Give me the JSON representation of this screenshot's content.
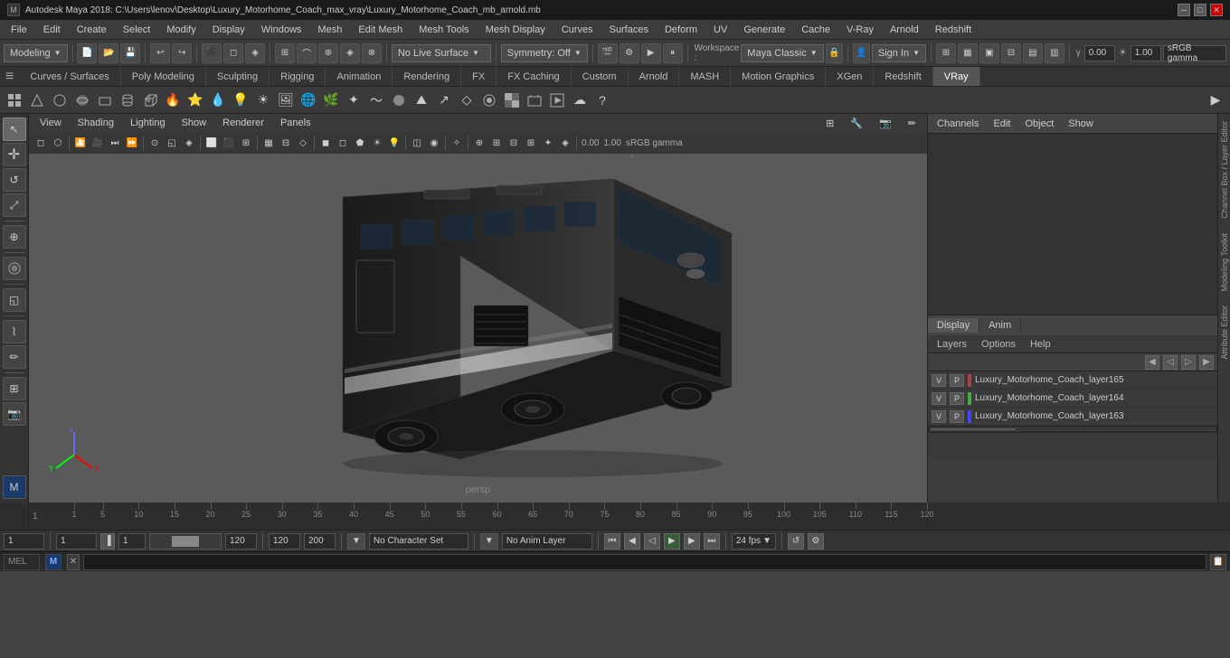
{
  "titlebar": {
    "title": "Autodesk Maya 2018: C:\\Users\\lenov\\Desktop\\Luxury_Motorhome_Coach_max_vray\\Luxury_Motorhome_Coach_mb_arnold.mb",
    "icon": "M"
  },
  "menubar": {
    "items": [
      "File",
      "Edit",
      "Create",
      "Select",
      "Modify",
      "Display",
      "Windows",
      "Mesh",
      "Edit Mesh",
      "Mesh Tools",
      "Mesh Display",
      "Curves",
      "Surfaces",
      "Deform",
      "UV",
      "Generate",
      "Cache",
      "V-Ray",
      "Arnold",
      "Redshift"
    ]
  },
  "toolbar1": {
    "mode_dropdown": "Modeling",
    "live_surface": "No Live Surface",
    "symmetry": "Symmetry: Off",
    "workspace_label": "Workspace :",
    "workspace_value": "Maya Classic",
    "sign_in": "Sign In",
    "gamma_value": "0.00",
    "exposure_value": "1.00",
    "color_mode": "sRGB gamma"
  },
  "tabs": {
    "menu_icon": "≡",
    "items": [
      {
        "label": "Curves / Surfaces",
        "active": false
      },
      {
        "label": "Poly Modeling",
        "active": false
      },
      {
        "label": "Sculpting",
        "active": false
      },
      {
        "label": "Rigging",
        "active": false
      },
      {
        "label": "Animation",
        "active": false
      },
      {
        "label": "Rendering",
        "active": false
      },
      {
        "label": "FX",
        "active": false
      },
      {
        "label": "FX Caching",
        "active": false
      },
      {
        "label": "Custom",
        "active": false
      },
      {
        "label": "Arnold",
        "active": false
      },
      {
        "label": "MASH",
        "active": false
      },
      {
        "label": "Motion Graphics",
        "active": false
      },
      {
        "label": "XGen",
        "active": false
      },
      {
        "label": "Redshift",
        "active": false
      },
      {
        "label": "VRay",
        "active": true
      }
    ]
  },
  "viewport": {
    "menus": [
      "View",
      "Shading",
      "Lighting",
      "Show",
      "Renderer",
      "Panels"
    ],
    "persp_label": "persp"
  },
  "right_panel": {
    "header_items": [
      "Channels",
      "Edit",
      "Object",
      "Show"
    ],
    "vtabs": [
      "Channel Box / Layer Editor",
      "Modeling Toolkit",
      "Attribute Editor"
    ],
    "layer_tabs": [
      "Display",
      "Anim"
    ],
    "layer_sub_tabs": [
      "Layers",
      "Options",
      "Help"
    ],
    "layers": [
      {
        "v": "V",
        "p": "P",
        "name": "Luxury_Motorhome_Coach_layer165",
        "color": "#aa4444"
      },
      {
        "v": "V",
        "p": "P",
        "name": "Luxury_Motorhome_Coach_layer164",
        "color": "#44aa44"
      },
      {
        "v": "V",
        "p": "P",
        "name": "Luxury_Motorhome_Coach_layer163",
        "color": "#4444ff"
      }
    ]
  },
  "timeline": {
    "ticks": [
      1,
      5,
      10,
      15,
      20,
      25,
      30,
      35,
      40,
      45,
      50,
      55,
      60,
      65,
      70,
      75,
      80,
      85,
      90,
      95,
      100,
      105,
      110,
      115,
      120
    ],
    "start_frame": "1",
    "end_frame": "120",
    "current_frame": "1",
    "playback_start": "1",
    "playback_end": "120",
    "range_start": "120",
    "range_end": "200"
  },
  "bottom_controls": {
    "frame_display": "1",
    "frame_input": "1",
    "anim_layer_display": "1",
    "anim_layer_value": "120",
    "range_start": "120",
    "range_end": "200",
    "no_character_set": "No Character Set",
    "no_anim_layer": "No Anim Layer",
    "fps": "24 fps",
    "playback_buttons": [
      "⏮",
      "⏭",
      "◀",
      "▶",
      "⏩",
      "⏪",
      "⏹"
    ]
  },
  "status_bar": {
    "mel_label": "MEL",
    "history_icon": "📋"
  }
}
